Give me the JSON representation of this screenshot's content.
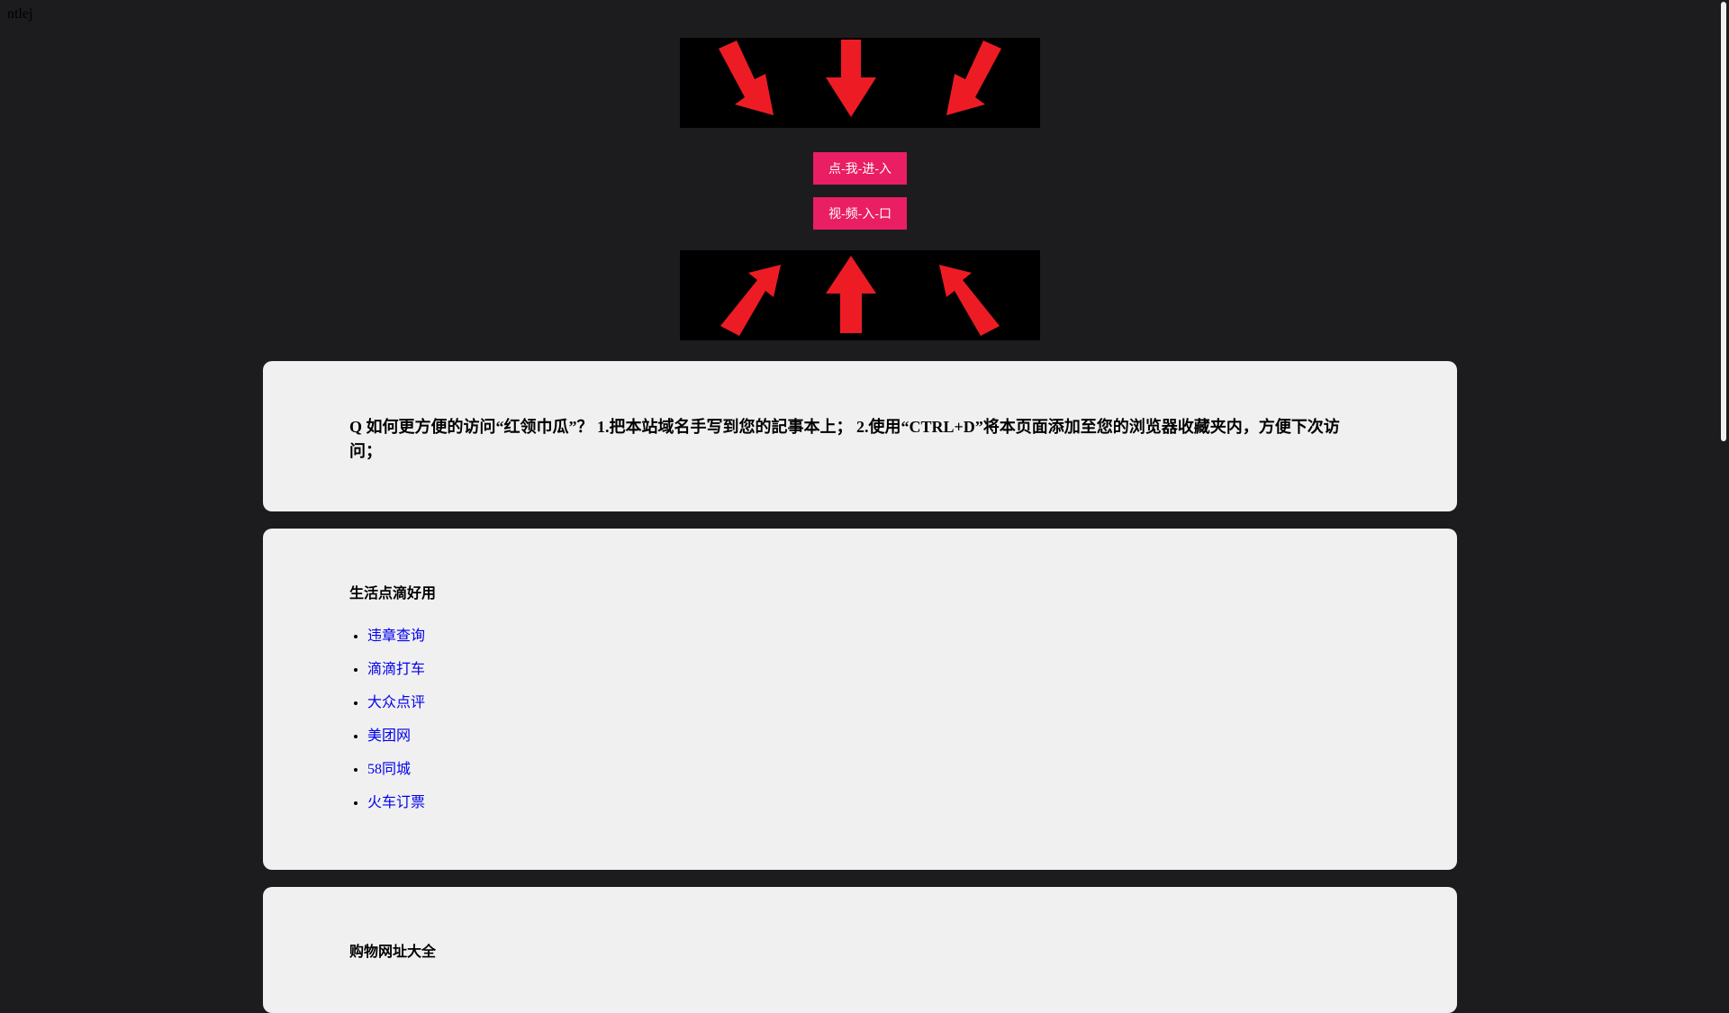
{
  "corner_text": "ntlej",
  "buttons": {
    "enter": "点-我-进-入",
    "video": "视-频-入-口"
  },
  "arrows": {
    "color": "#ed1c24",
    "top_icons": [
      "arrow-down-right-icon",
      "arrow-down-icon",
      "arrow-down-left-icon"
    ],
    "bottom_icons": [
      "arrow-up-right-icon",
      "arrow-up-icon",
      "arrow-up-left-icon"
    ]
  },
  "accent_color": "#e91e63",
  "notice": {
    "text": "Q 如何更方便的访问“红领巾瓜”？ 1.把本站域名手写到您的記事本上； 2.使用“CTRL+D”将本页面添加至您的浏览器收藏夹内，方便下次访问；"
  },
  "life_section": {
    "title": "生活点滴好用",
    "links": [
      "违章查询",
      "滴滴打车",
      "大众点评",
      "美团网",
      "58同城",
      "火车订票"
    ]
  },
  "shop_section": {
    "title": "购物网址大全"
  }
}
